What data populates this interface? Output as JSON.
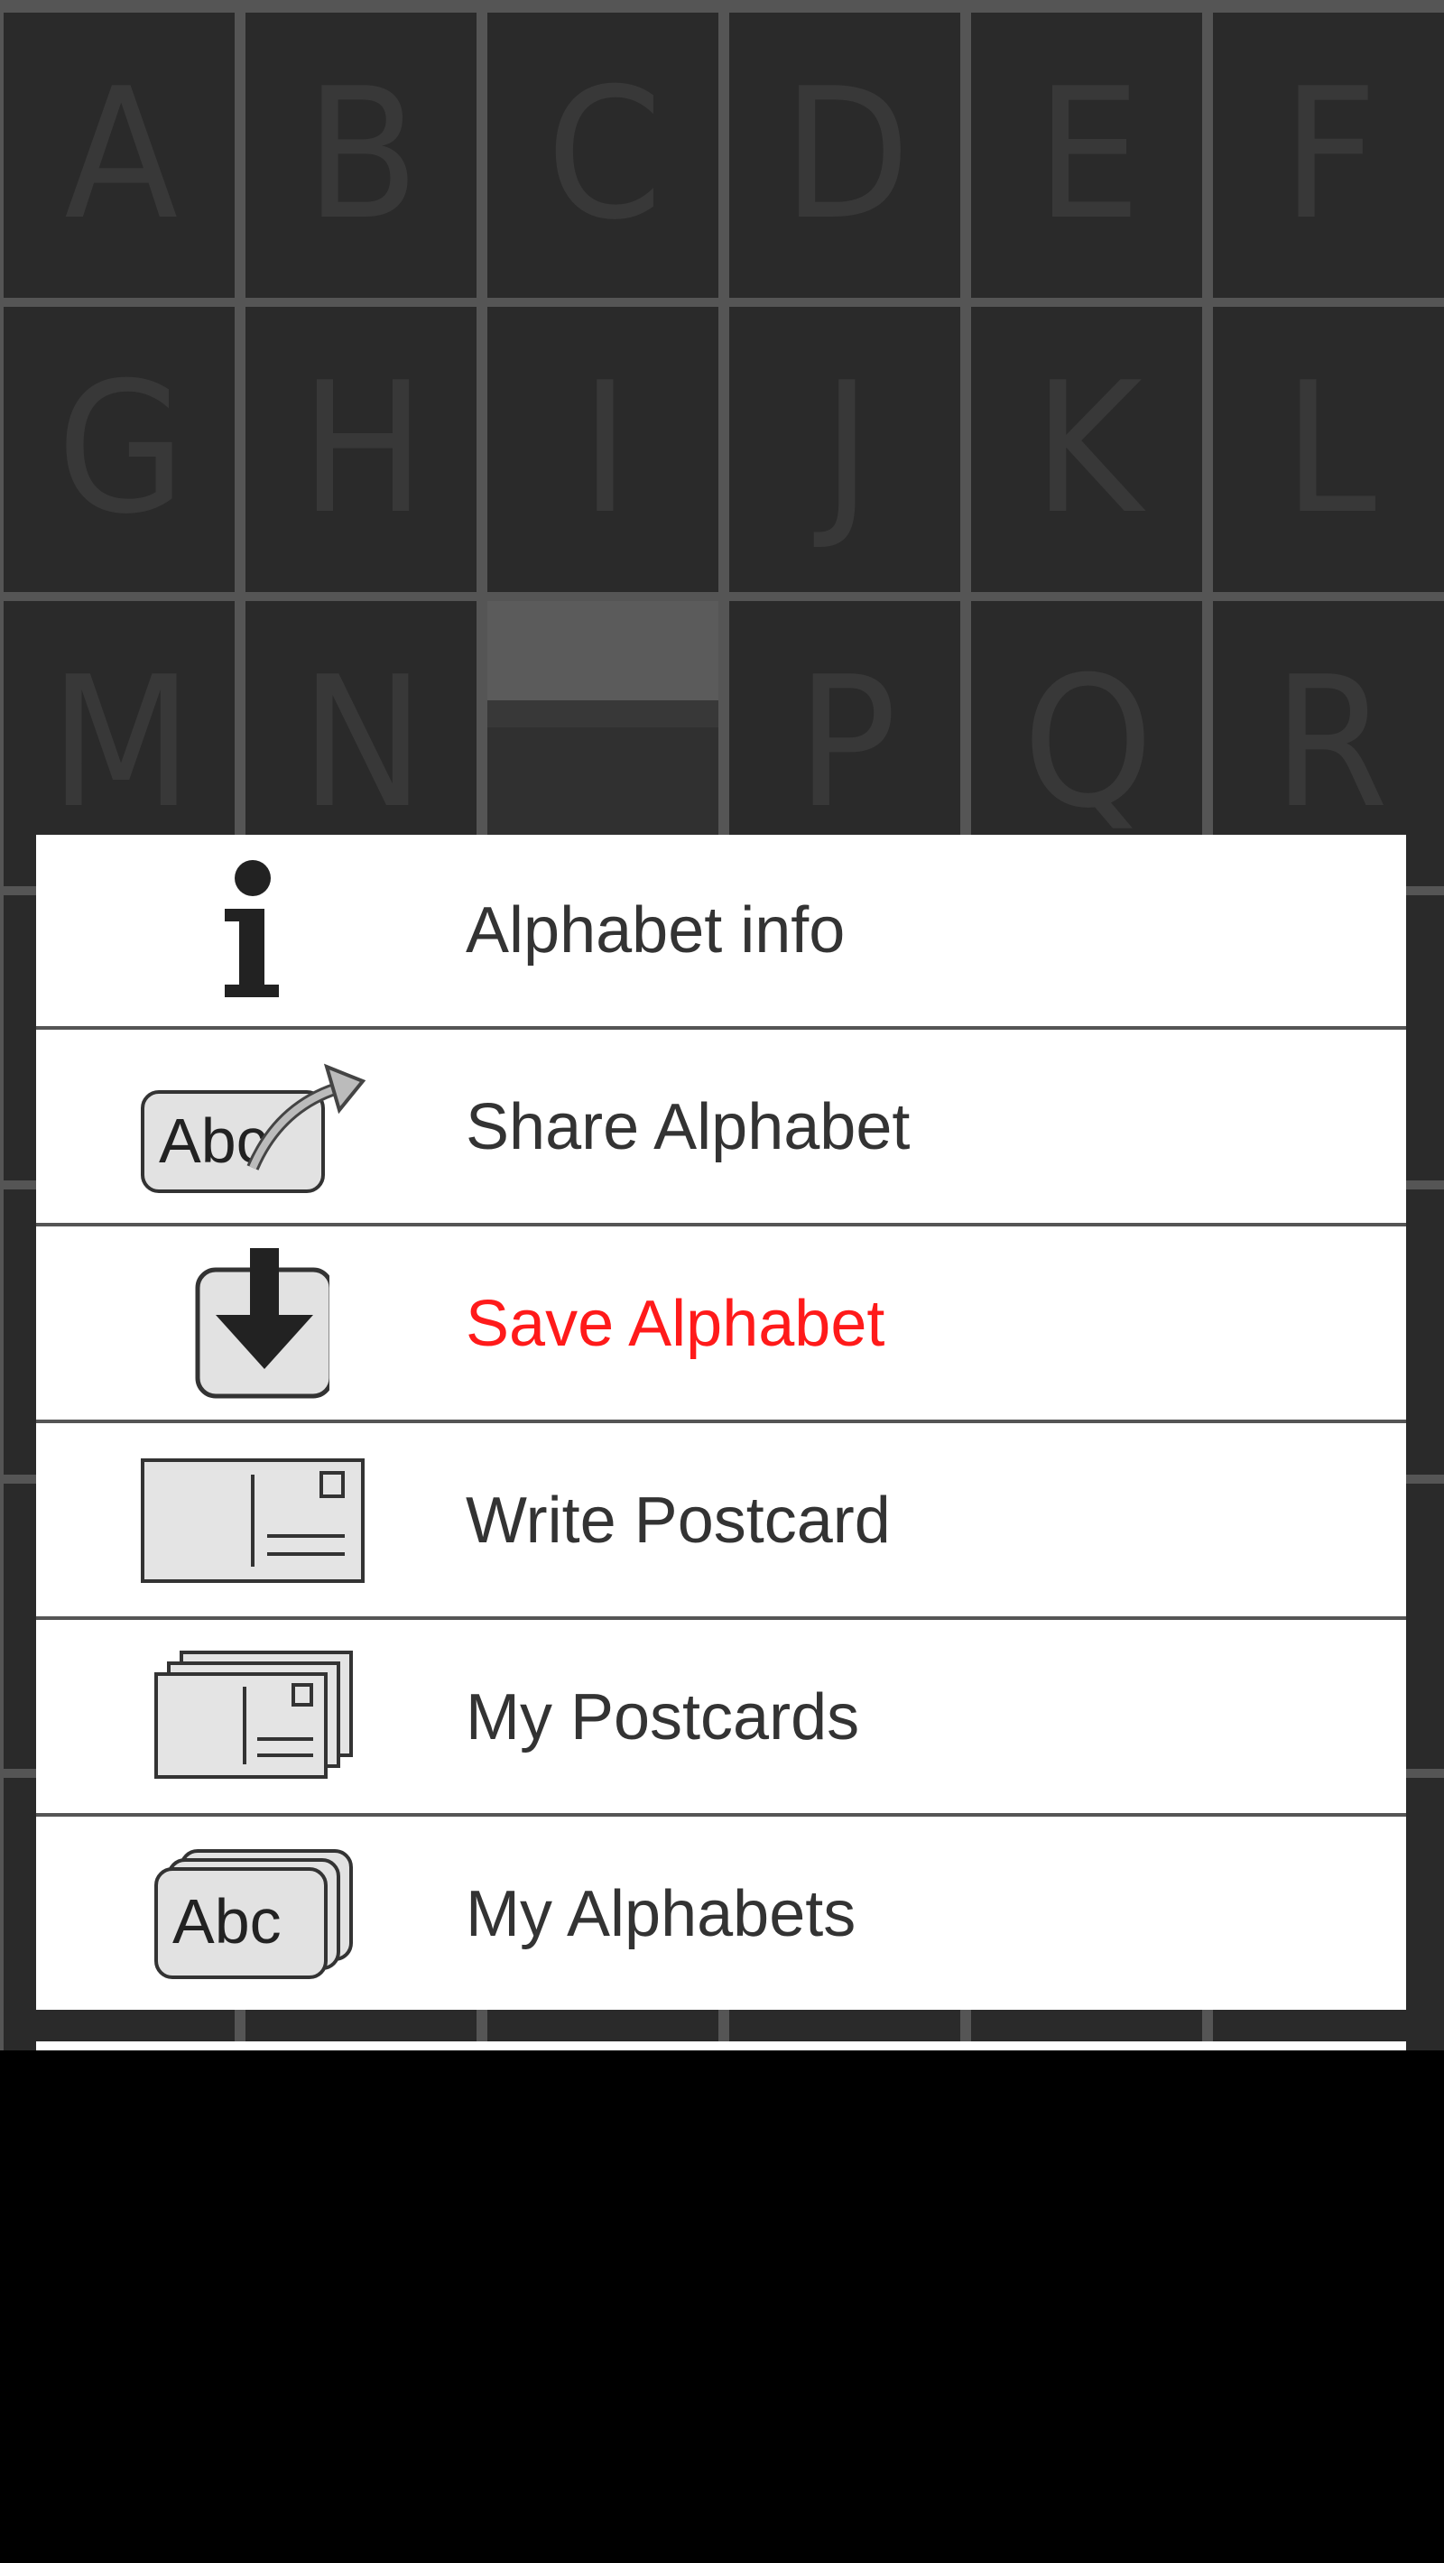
{
  "grid": {
    "rows": [
      [
        "A",
        "B",
        "C",
        "D",
        "E",
        "F"
      ],
      [
        "G",
        "H",
        "I",
        "J",
        "K",
        "L"
      ],
      [
        "M",
        "N",
        "",
        "P",
        "Q",
        "R"
      ],
      [
        "",
        "",
        "",
        "",
        "",
        ""
      ],
      [
        "",
        "",
        "",
        "",
        "",
        ""
      ],
      [
        "",
        "",
        "",
        "",
        "",
        ""
      ],
      [
        "",
        "",
        "",
        "",
        "",
        ""
      ]
    ]
  },
  "menu": {
    "items": [
      {
        "label": "Alphabet info",
        "icon": "info-icon"
      },
      {
        "label": "Share Alphabet",
        "icon": "share-alphabet-icon",
        "icon_text": "Abc"
      },
      {
        "label": "Save Alphabet",
        "icon": "save-icon",
        "color": "#ff1a1a"
      },
      {
        "label": "Write Postcard",
        "icon": "postcard-icon"
      },
      {
        "label": "My Postcards",
        "icon": "postcard-stack-icon"
      },
      {
        "label": "My Alphabets",
        "icon": "alphabet-stack-icon",
        "icon_text": "Abc"
      }
    ]
  }
}
